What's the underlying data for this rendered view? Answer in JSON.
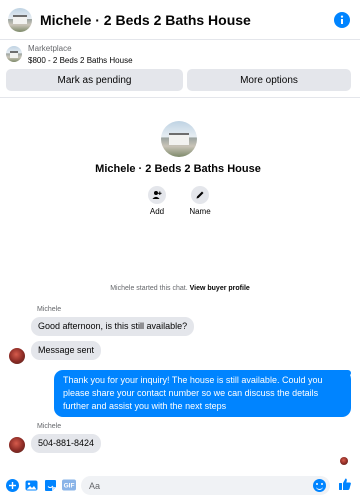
{
  "header": {
    "title": "Michele · 2 Beds 2 Baths House"
  },
  "marketplace": {
    "label": "Marketplace",
    "listing": "$800 - 2 Beds 2 Baths House",
    "buttons": {
      "pending": "Mark as pending",
      "more": "More options"
    }
  },
  "profile": {
    "name": "Michele · 2 Beds 2 Baths House",
    "actions": {
      "add": "Add",
      "name": "Name"
    }
  },
  "chat": {
    "started_prefix": "Michele started this chat.",
    "started_link": "View buyer profile",
    "messages": [
      {
        "sender": "Michele",
        "text": "Good afternoon, is this still available?"
      },
      {
        "text": "Message sent"
      },
      {
        "text": "Thank you for your inquiry! The house is still available. Could you please share your contact number so we can discuss the details further and assist you with the next steps"
      },
      {
        "sender": "Michele",
        "text": "504-881-8424"
      }
    ]
  },
  "composer": {
    "placeholder": "Aa"
  },
  "icons": {
    "info": "info-icon",
    "add_person": "add-person-icon",
    "edit": "pencil-icon",
    "plus": "plus-icon",
    "photo": "photo-icon",
    "sticker": "sticker-icon",
    "gif": "gif-icon",
    "emoji": "emoji-icon",
    "like": "thumbs-up-icon"
  },
  "colors": {
    "accent": "#0084ff",
    "bubble_in": "#e4e6eb"
  }
}
